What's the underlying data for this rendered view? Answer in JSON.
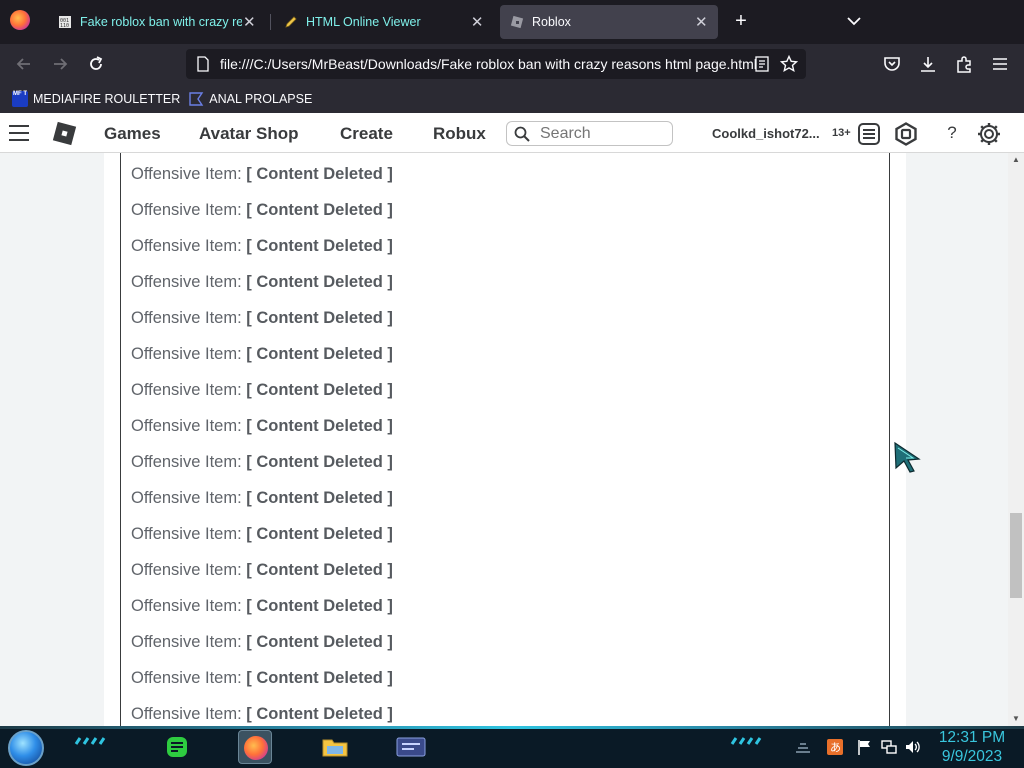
{
  "browser": {
    "tabs": [
      {
        "label": "Fake roblox ban with crazy reasons html page.html",
        "active": false
      },
      {
        "label": "HTML Online Viewer",
        "active": false
      },
      {
        "label": "Roblox",
        "active": true
      }
    ],
    "url": "file:///C:/Users/MrBeast/Downloads/Fake roblox ban with crazy reasons html page.html",
    "bookmarks": [
      {
        "icon": "mediafire-icon",
        "icon_text": "MF T",
        "label": "MEDIAFIRE ROULETTER"
      },
      {
        "icon": "bookmark-page-icon",
        "label": "ANAL PROLAPSE"
      }
    ]
  },
  "roblox_header": {
    "nav": [
      "Games",
      "Avatar Shop",
      "Create",
      "Robux"
    ],
    "search_placeholder": "Search",
    "username": "Coolkd_ishot72...",
    "age_badge": "13+",
    "help_label": "?"
  },
  "content": {
    "item_prefix": "Offensive Item:",
    "items": [
      "[ Content Deleted ]",
      "[ Content Deleted ]",
      "[ Content Deleted ]",
      "[ Content Deleted ]",
      "[ Content Deleted ]",
      "[ Content Deleted ]",
      "[ Content Deleted ]",
      "[ Content Deleted ]",
      "[ Content Deleted ]",
      "[ Content Deleted ]",
      "[ Content Deleted ]",
      "[ Content Deleted ]",
      "[ Content Deleted ]",
      "[ Content Deleted ]",
      "[ Content Deleted ]",
      "[ Content Deleted ]"
    ]
  },
  "taskbar": {
    "apps": [
      "notes-app-icon",
      "firefox-icon",
      "file-explorer-icon",
      "media-app-icon"
    ],
    "tray": [
      "language-icon",
      "flag-icon",
      "network-icon",
      "volume-icon"
    ],
    "time": "12:31 PM",
    "date": "9/9/2023"
  },
  "colors": {
    "tab_text": "#7ff0ea",
    "roblox_text": "#393b3d",
    "clock": "#39c6dd"
  }
}
